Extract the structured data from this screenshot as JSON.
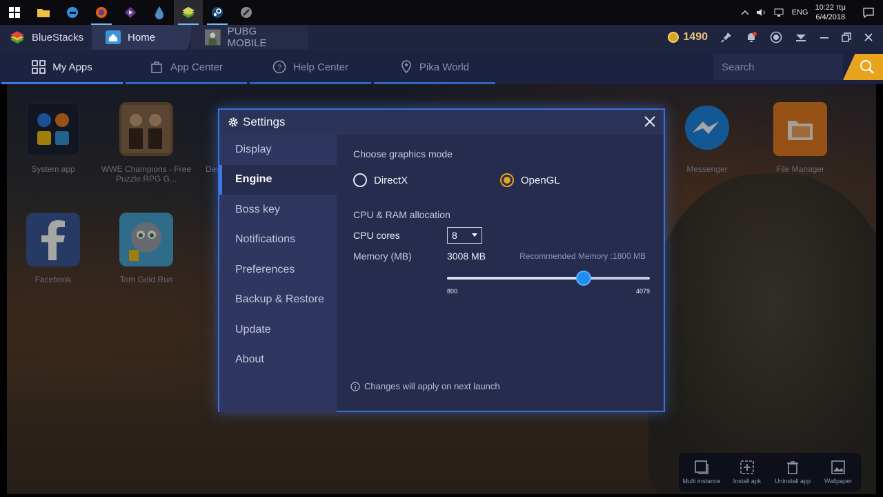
{
  "taskbar": {
    "apps": [
      "start",
      "file-explorer",
      "edge",
      "firefox",
      "media",
      "water-drop",
      "bluestacks",
      "steam",
      "brush"
    ],
    "tray": {
      "language": "ENG",
      "time": "10:22 πμ",
      "date": "6/4/2018"
    }
  },
  "bluestacks": {
    "brand": "BlueStacks",
    "tabs": [
      {
        "label": "Home"
      },
      {
        "label": "PUBG MOBILE"
      }
    ],
    "coins": "1490",
    "nav": [
      {
        "label": "My Apps",
        "icon": "grid-icon"
      },
      {
        "label": "App Center",
        "icon": "bag-icon"
      },
      {
        "label": "Help Center",
        "icon": "help-icon"
      },
      {
        "label": "Pika World",
        "icon": "pin-icon"
      }
    ],
    "search_placeholder": "Search"
  },
  "desktop": {
    "apps": [
      {
        "label": "System app",
        "color": "#3a4466"
      },
      {
        "label": "WWE Champions - Free Puzzle RPG G...",
        "color": "#7a5a3e"
      },
      {
        "label": "Dev",
        "color": "#2c3245"
      },
      {
        "label": "Facebook",
        "color": "#3b5998"
      },
      {
        "label": "Tom Gold Run",
        "color": "#48a7d4"
      },
      {
        "label": "Messenger",
        "color": "#1e88e5"
      },
      {
        "label": "File Manager",
        "color": "#e67e22"
      }
    ],
    "dock": [
      {
        "label": "Multi instance"
      },
      {
        "label": "Install apk"
      },
      {
        "label": "Uninstall app"
      },
      {
        "label": "Wallpaper"
      }
    ]
  },
  "settings": {
    "title": "Settings",
    "menu": [
      {
        "label": "Display",
        "active": false
      },
      {
        "label": "Engine",
        "active": true
      },
      {
        "label": "Boss key",
        "active": false
      },
      {
        "label": "Notifications",
        "active": false
      },
      {
        "label": "Preferences",
        "active": false
      },
      {
        "label": "Backup & Restore",
        "active": false
      },
      {
        "label": "Update",
        "active": false
      },
      {
        "label": "About",
        "active": false
      }
    ],
    "graphics_title": "Choose graphics mode",
    "graphics_options": [
      {
        "label": "DirectX",
        "selected": false
      },
      {
        "label": "OpenGL",
        "selected": true
      }
    ],
    "alloc_title": "CPU & RAM allocation",
    "cpu_label": "CPU cores",
    "cpu_value": "8",
    "memory_label": "Memory (MB)",
    "memory_value": "3008 MB",
    "memory_recommended": "Recommended Memory :1800 MB",
    "memory_min": "800",
    "memory_max": "4079",
    "memory_current": 3008,
    "note": "Changes will apply on next launch"
  }
}
